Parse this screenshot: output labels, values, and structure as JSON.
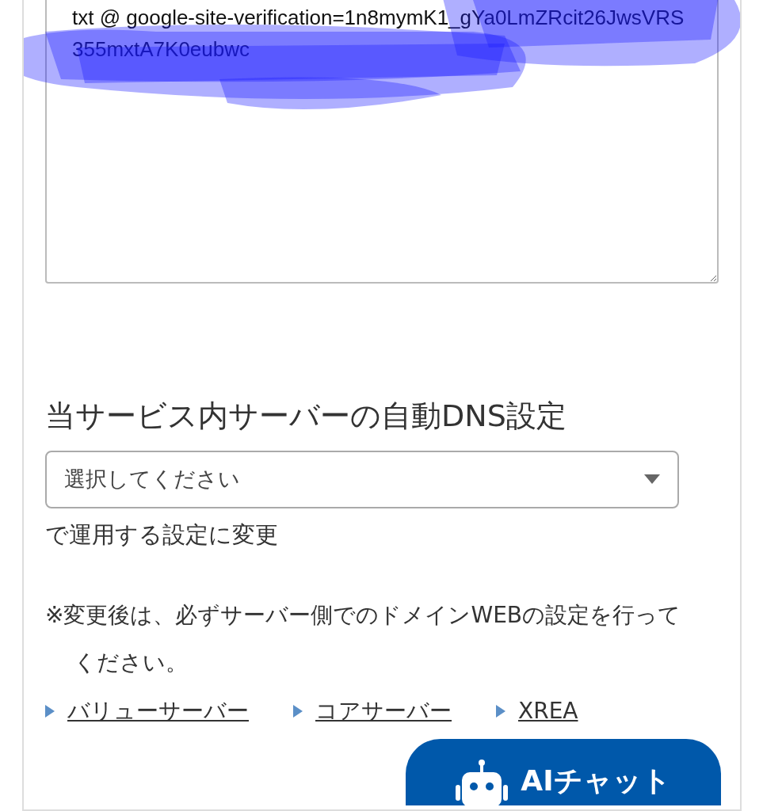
{
  "textarea": {
    "value": "txt @ google-site-verification=1n8mymK1_gYa0LmZRcit26JwsVRS355mxtA7K0eubwc"
  },
  "heading": "当サービス内サーバーの自動DNS設定",
  "select": {
    "placeholder": "選択してください"
  },
  "select_suffix": "で運用する設定に変更",
  "note": "※変更後は、必ずサーバー側でのドメインWEBの設定を行ってください。",
  "links": [
    {
      "label": "バリューサーバー"
    },
    {
      "label": "コアサーバー"
    },
    {
      "label": "XREA"
    }
  ],
  "chat_button": {
    "label": "AIチャット"
  }
}
